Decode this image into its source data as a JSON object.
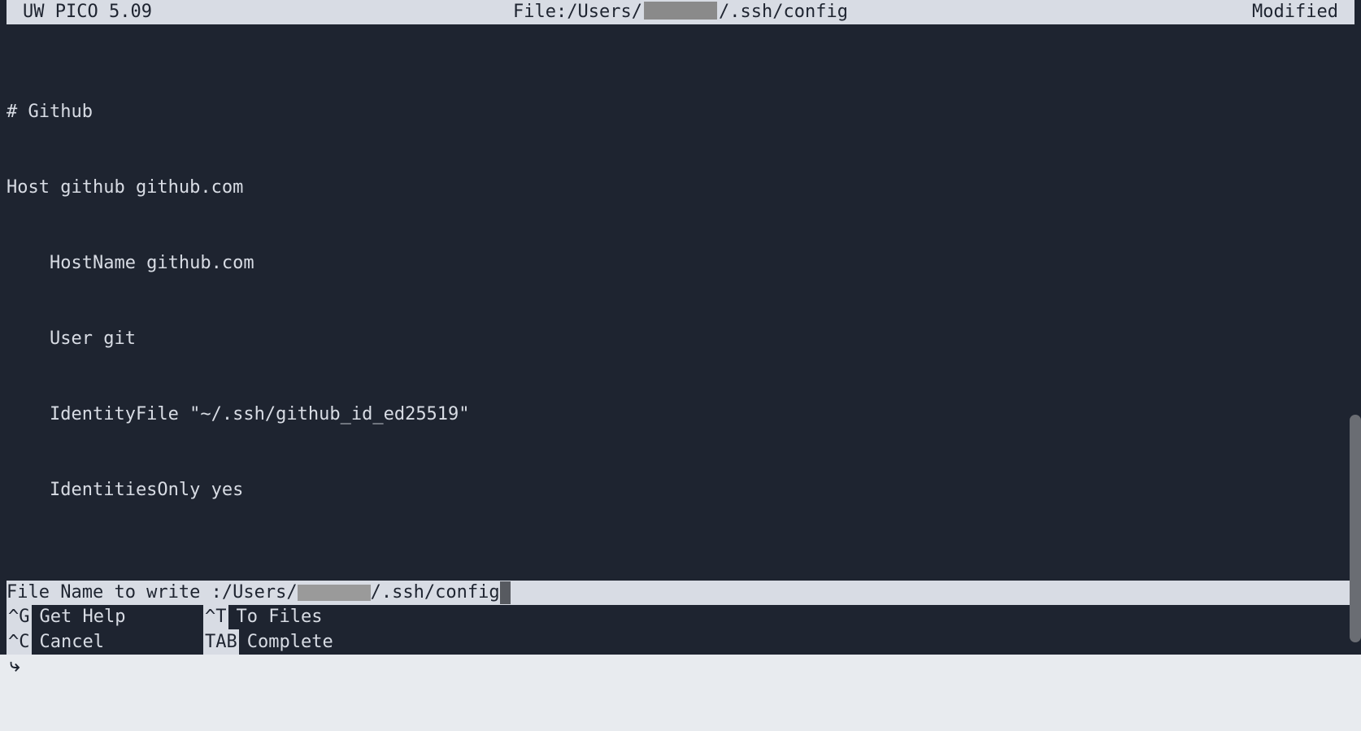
{
  "titleBar": {
    "appName": "UW PICO 5.09",
    "fileLabel": "File: ",
    "filePathPrefix": "/Users/",
    "filePathSuffix": "/.ssh/config",
    "status": "Modified"
  },
  "editor": {
    "lines": [
      "# Github",
      "Host github github.com",
      "    HostName github.com",
      "    User git",
      "    IdentityFile \"~/.ssh/github_id_ed25519\"",
      "    IdentitiesOnly yes"
    ]
  },
  "prompt": {
    "label": "File Name to write : ",
    "valuePrefix": "/Users/",
    "valueSuffix": "/.ssh/config"
  },
  "shortcuts": {
    "row1": [
      {
        "key": "^G",
        "label": "Get Help"
      },
      {
        "key": "^T",
        "label": "To Files"
      }
    ],
    "row2": [
      {
        "key": "^C",
        "label": "Cancel"
      },
      {
        "key": "TAB",
        "label": "Complete"
      }
    ]
  },
  "shellPrompt": "⤷"
}
